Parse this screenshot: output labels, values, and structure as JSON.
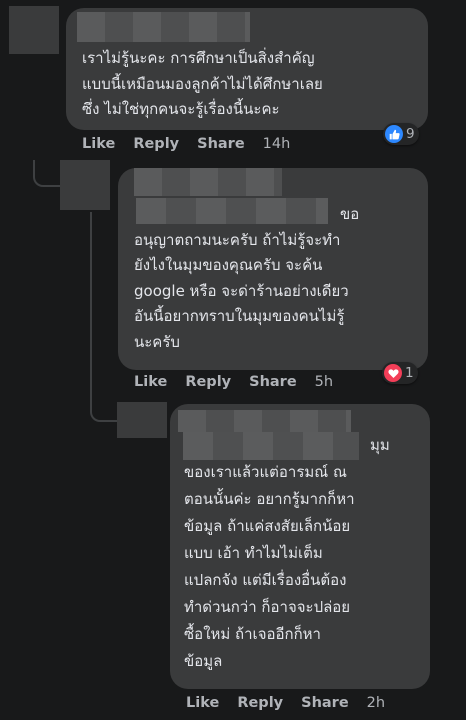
{
  "comments": [
    {
      "text": "เราไม่รู้นะคะ การศึกษาเป็นสิ่งสำคัญ\nแบบนี้เหมือนมองลูกค้าไม่ได้ศึกษาเลย\nซึ่ง ไม่ใช่ทุกคนจะรู้เรื่องนี้นะคะ",
      "reaction_icon": "like-icon",
      "reaction_count": "9",
      "actions": {
        "like": "Like",
        "reply": "Reply",
        "share": "Share",
        "time": "14h"
      }
    },
    {
      "text": "ขอ\nอนุญาตถามนะครับ ถ้าไม่รู้จะทำ\nยังไงในมุมของคุณครับ จะค้น\ngoogle หรือ จะด่าร้านอย่างเดียว\nอันนี้อยากทราบในมุมของคนไม่รู้\nนะครับ",
      "reaction_icon": "heart-icon",
      "reaction_count": "1",
      "actions": {
        "like": "Like",
        "reply": "Reply",
        "share": "Share",
        "time": "5h"
      }
    },
    {
      "text": "มุม\nของเราแล้วแต่อารมณ์ ณ\nตอนนั้นค่ะ อยากรู้มากก็หา\nข้อมูล ถ้าแค่สงสัยเล็กน้อย\nแบบ เอ้า ทำไมไม่เต็ม\nแปลกจัง แต่มีเรื่องอื่นต้อง\nทำด่วนกว่า ก็อาจจะปล่อย\nซื้อใหม่ ถ้าเจออีกก็หา\nข้อมูล",
      "actions": {
        "like": "Like",
        "reply": "Reply",
        "share": "Share",
        "time": "2h"
      }
    }
  ],
  "colors": {
    "background": "#18191a",
    "bubble": "#3a3b3c",
    "text": "#e4e6eb",
    "secondary_text": "#b0b3b8",
    "like_blue": "#2d88ff",
    "love_red": "#f33e58"
  }
}
